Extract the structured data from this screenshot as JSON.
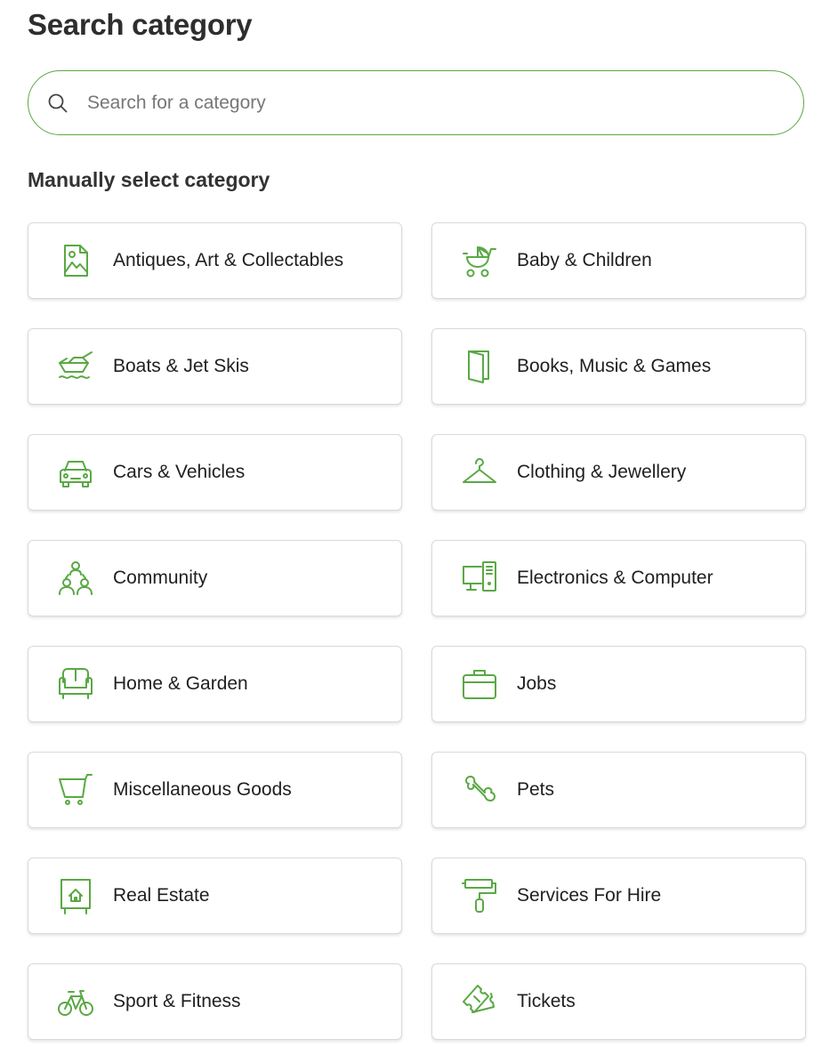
{
  "header": {
    "title": "Search category"
  },
  "search": {
    "placeholder": "Search for a category",
    "value": ""
  },
  "section": {
    "title": "Manually select category"
  },
  "categories": [
    {
      "label": "Antiques, Art & Collectables",
      "icon": "picture-frame-icon"
    },
    {
      "label": "Baby & Children",
      "icon": "pram-icon"
    },
    {
      "label": "Boats & Jet Skis",
      "icon": "boat-icon"
    },
    {
      "label": "Books, Music & Games",
      "icon": "book-icon"
    },
    {
      "label": "Cars & Vehicles",
      "icon": "car-icon"
    },
    {
      "label": "Clothing & Jewellery",
      "icon": "coat-hanger-icon"
    },
    {
      "label": "Community",
      "icon": "people-group-icon"
    },
    {
      "label": "Electronics & Computer",
      "icon": "desktop-computer-icon"
    },
    {
      "label": "Home & Garden",
      "icon": "sofa-icon"
    },
    {
      "label": "Jobs",
      "icon": "briefcase-icon"
    },
    {
      "label": "Miscellaneous Goods",
      "icon": "shopping-cart-icon"
    },
    {
      "label": "Pets",
      "icon": "bone-icon"
    },
    {
      "label": "Real Estate",
      "icon": "house-sign-icon"
    },
    {
      "label": "Services For Hire",
      "icon": "paint-roller-icon"
    },
    {
      "label": "Sport & Fitness",
      "icon": "bicycle-icon"
    },
    {
      "label": "Tickets",
      "icon": "ticket-icon"
    }
  ],
  "colors": {
    "accent": "#5aa844",
    "border": "#d9d9d9",
    "text": "#1f1f1f"
  }
}
